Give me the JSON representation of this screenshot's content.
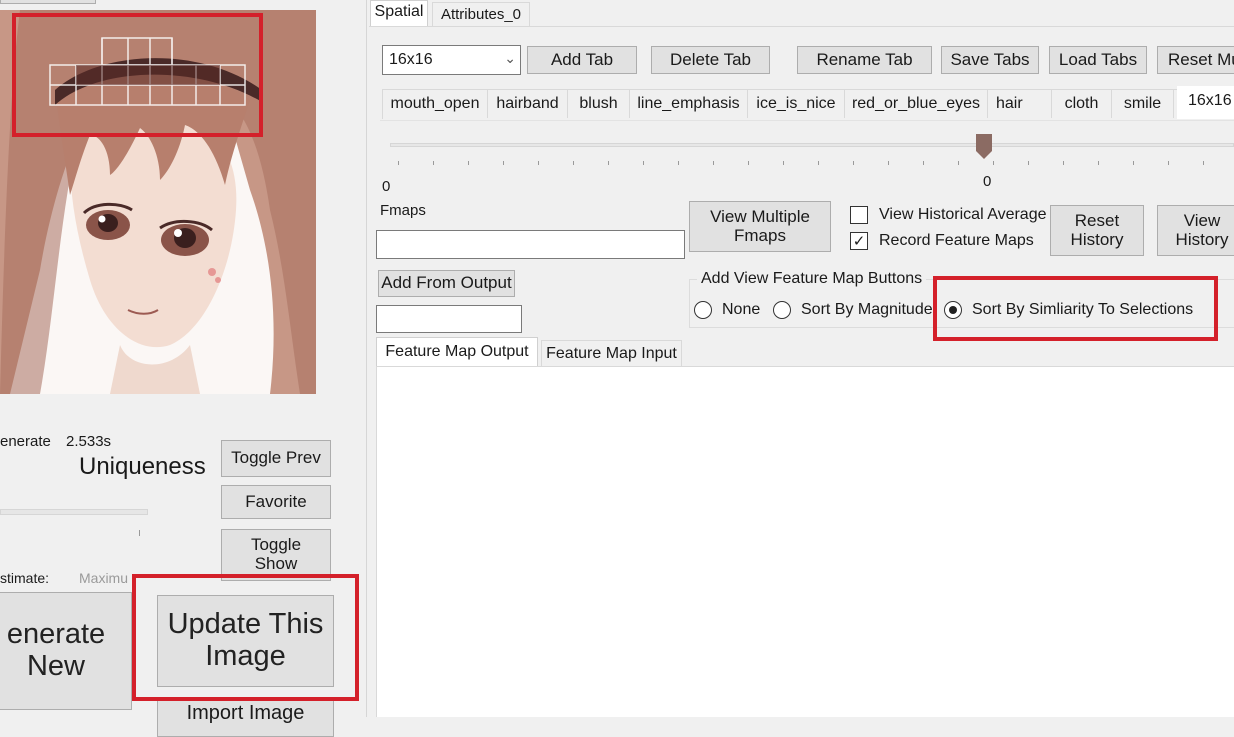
{
  "left": {
    "generate_label": "enerate",
    "generate_time": "2.533s",
    "uniqueness_label": "Uniqueness",
    "toggle_prev": "Toggle Prev",
    "favorite": "Favorite",
    "toggle_show": "Toggle\nShow",
    "estimate_label": "stimate:",
    "estimate_value": "Maximu",
    "generate_new": "enerate\nNew",
    "update_image": "Update This\nImage",
    "import_image": "Import Image"
  },
  "tabs": {
    "spatial": "Spatial",
    "attributes": "Attributes_0"
  },
  "toolbar": {
    "grid_select": "16x16",
    "add_tab": "Add Tab",
    "delete_tab": "Delete Tab",
    "rename_tab": "Rename Tab",
    "save_tabs": "Save Tabs",
    "load_tabs": "Load Tabs",
    "reset": "Reset Mu"
  },
  "attribute_tabs": [
    "mouth_open",
    "hairband",
    "blush",
    "line_emphasis",
    "ice_is_nice",
    "red_or_blue_eyes",
    "hair",
    "cloth",
    "smile",
    "16x16"
  ],
  "slider": {
    "min_label": "0",
    "value_label": "0",
    "value_fraction": 0.71
  },
  "fmaps": {
    "label": "Fmaps",
    "view_multiple": "View Multiple\nFmaps",
    "view_hist_avg": "View Historical Average",
    "record_fmaps": "Record Feature Maps",
    "reset_history": "Reset\nHistory",
    "view_history": "View\nHistory",
    "add_from_output": "Add From Output"
  },
  "view_buttons": {
    "group_label": "Add View Feature Map Buttons",
    "none": "None",
    "by_magnitude": "Sort By Magnitude",
    "by_similarity": "Sort By Simliarity To Selections",
    "selected": "by_similarity"
  },
  "fm_tabs": {
    "output": "Feature Map Output",
    "input": "Feature Map Input"
  },
  "colors": {
    "highlight": "#d4202a",
    "window_bg": "#f0f0f0",
    "button_bg": "#e1e1e1"
  }
}
